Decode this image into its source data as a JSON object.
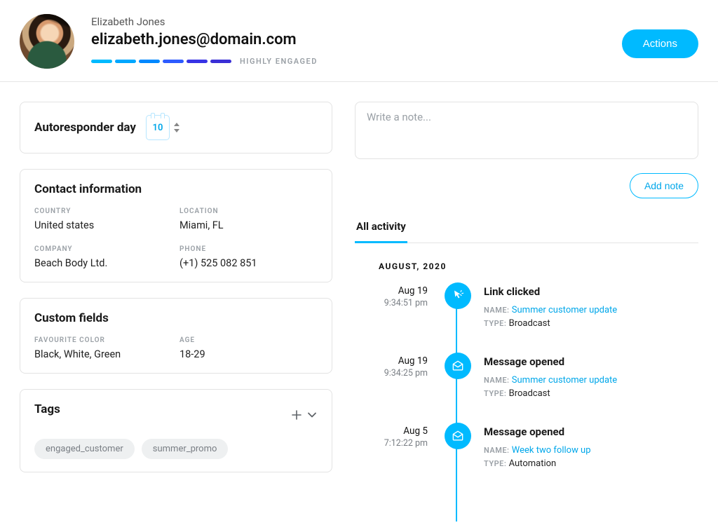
{
  "header": {
    "name": "Elizabeth Jones",
    "email": "elizabeth.jones@domain.com",
    "engagement_label": "HIGHLY ENGAGED",
    "actions_button": "Actions"
  },
  "autoresponder": {
    "title": "Autoresponder day",
    "day_value": "10"
  },
  "contact_info": {
    "heading": "Contact information",
    "fields": [
      {
        "label": "COUNTRY",
        "value": "United states"
      },
      {
        "label": "LOCATION",
        "value": "Miami, FL"
      },
      {
        "label": "COMPANY",
        "value": "Beach Body Ltd."
      },
      {
        "label": "PHONE",
        "value": "(+1) 525 082 851"
      }
    ]
  },
  "custom_fields": {
    "heading": "Custom fields",
    "fields": [
      {
        "label": "FAVOURITE COLOR",
        "value": "Black, White, Green"
      },
      {
        "label": "AGE",
        "value": "18-29"
      }
    ]
  },
  "tags": {
    "heading": "Tags",
    "items": [
      "engaged_customer",
      "summer_promo"
    ]
  },
  "notes": {
    "placeholder": "Write a note...",
    "add_button": "Add note"
  },
  "activity": {
    "tab_label": "All activity",
    "month_header": "AUGUST, 2020",
    "meta_labels": {
      "name": "NAME:",
      "type": "TYPE:"
    },
    "items": [
      {
        "date": "Aug 19",
        "time": "9:34:51 pm",
        "icon": "click",
        "title": "Link clicked",
        "name": "Summer customer update",
        "type": "Broadcast"
      },
      {
        "date": "Aug 19",
        "time": "9:34:25 pm",
        "icon": "open",
        "title": "Message opened",
        "name": "Summer customer update",
        "type": "Broadcast"
      },
      {
        "date": "Aug 5",
        "time": "7:12:22 pm",
        "icon": "open",
        "title": "Message opened",
        "name": "Week two follow up",
        "type": "Automation"
      }
    ]
  }
}
